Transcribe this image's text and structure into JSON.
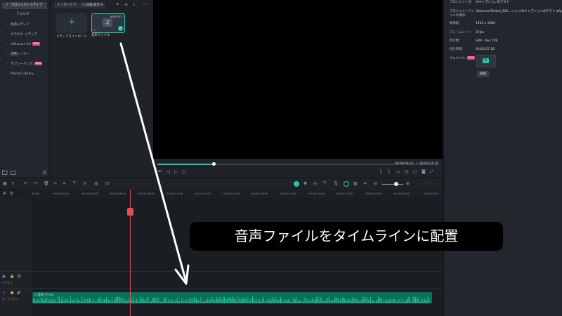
{
  "sidebar": {
    "items": [
      {
        "label": "プロジェクトメディア",
        "chevron": "▾",
        "active": true
      },
      {
        "label": "フォルダ",
        "chevron": "",
        "active": false
      },
      {
        "label": "共有メディア",
        "chevron": "›",
        "active": false
      },
      {
        "label": "クラウド メディア",
        "chevron": "›",
        "active": false
      },
      {
        "label": "Influence Kit",
        "chevron": "›",
        "active": false,
        "badge": "NEW"
      },
      {
        "label": "調整レイヤー",
        "chevron": "›",
        "active": false
      },
      {
        "label": "サブシーケンス",
        "chevron": "›",
        "active": false,
        "badge": "NEW"
      },
      {
        "label": "Photos Library",
        "chevron": "",
        "active": false
      }
    ]
  },
  "media": {
    "import_label": "インポート",
    "record_label": "録画/録音",
    "import_tile_label": "メディアをインポート",
    "audio_tile_label": "音声ファイル",
    "audio_tile_duration": "00:02:27"
  },
  "preview": {
    "current_time": "00:00:06:22",
    "separator": "/",
    "total_time": "00:00:27:18",
    "progress": 0.2
  },
  "props": {
    "rows": [
      {
        "key": "プロジェクト名:",
        "value": "AIキャプションのテスト"
      },
      {
        "key": "プロジェクトファイルの場所:",
        "value": "/Volumes/Tested_S20...ション/AIキャプションのテスト.wfp"
      },
      {
        "key": "解像度:",
        "value": "1920 x 1080"
      },
      {
        "key": "フレームレート:",
        "value": "25fps"
      },
      {
        "key": "色空間:",
        "value": "SDR - Rec.709"
      },
      {
        "key": "再生時間:",
        "value": "00:00:27:18"
      },
      {
        "key": "サムネイル:",
        "value": "",
        "badge": "NEW"
      }
    ],
    "edit_label": "編集"
  },
  "ruler": {
    "ticks": [
      "00:00",
      "00:00:02:00",
      "00:00:04:00",
      "00:00:06:00",
      "00:00:08:00",
      "00:00:10:00",
      "00:00:12:00",
      "00:00:14:00",
      "00:00:16:00",
      "00:00:18:00",
      "00:00:20:00",
      "00:00:22:00",
      "00:00:24:00",
      "00:00:26:00",
      "00:00:28:0"
    ]
  },
  "tracks": {
    "video_label": "ビデオ 1",
    "audio_label": "オーディオ 1",
    "audio_clip_label": "音声ファイル"
  },
  "caption": "音声ファイルをタイムラインに配置",
  "colors": {
    "accent": "#27c4a5",
    "playhead": "#e0505a",
    "waveform": "#1fbf98",
    "badge": "#e0458f"
  }
}
